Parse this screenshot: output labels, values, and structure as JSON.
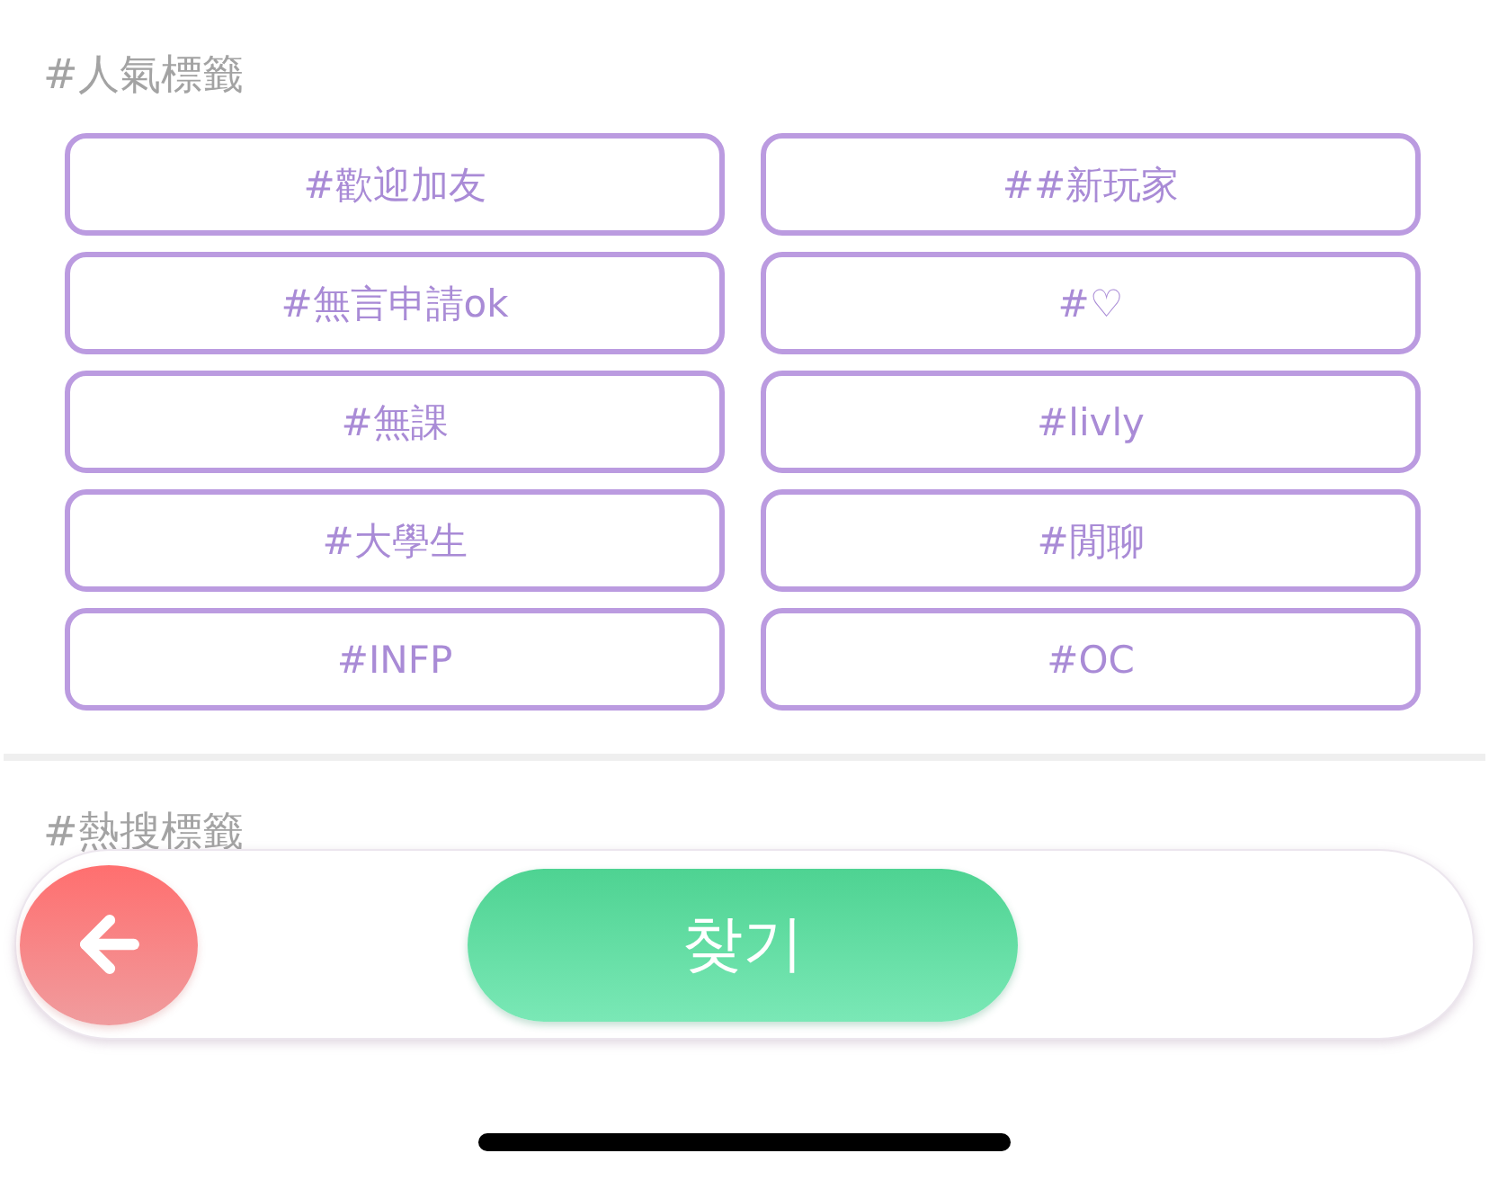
{
  "popular_tags": {
    "heading": "#人氣標籤",
    "tags": [
      {
        "label": "#歡迎加友"
      },
      {
        "label": "##新玩家"
      },
      {
        "label": "#無言申請ok"
      },
      {
        "label": "#♡"
      },
      {
        "label": "#無課"
      },
      {
        "label": "#livly"
      },
      {
        "label": "#大學生"
      },
      {
        "label": "#閒聊"
      },
      {
        "label": "#INFP"
      },
      {
        "label": "#OC"
      }
    ]
  },
  "trending_tags": {
    "heading": "#熱搜標籤"
  },
  "bottom_bar": {
    "search_button": "찾기"
  }
}
